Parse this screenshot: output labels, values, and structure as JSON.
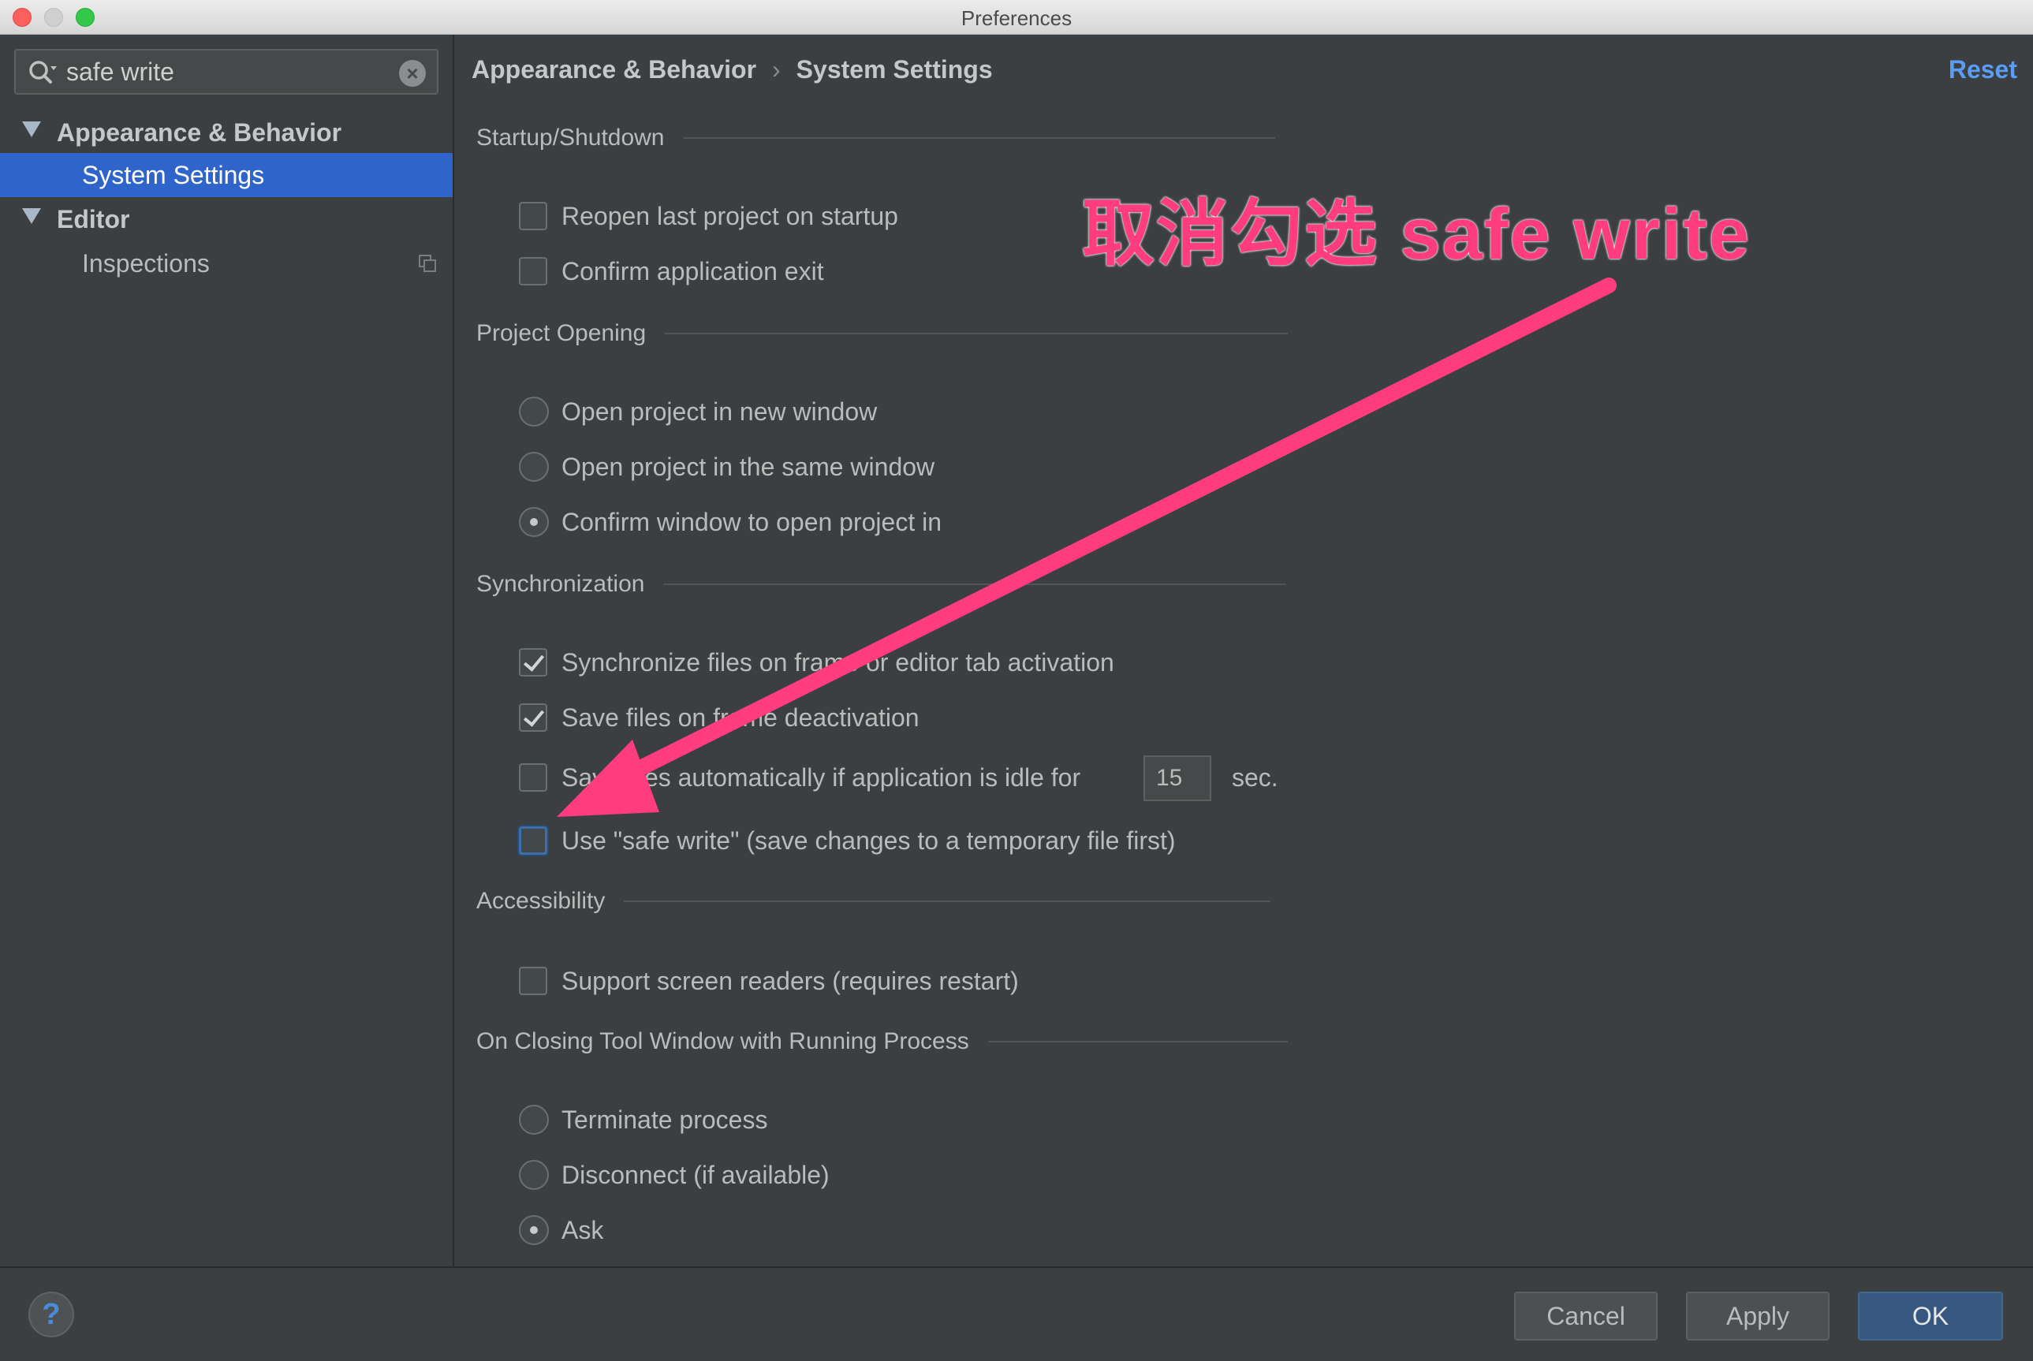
{
  "window": {
    "title": "Preferences"
  },
  "sidebar": {
    "search_value": "safe write",
    "tree": [
      {
        "label": "Appearance & Behavior",
        "level": "group"
      },
      {
        "label": "System Settings",
        "level": "child",
        "selected": true
      },
      {
        "label": "Editor",
        "level": "group"
      },
      {
        "label": "Inspections",
        "level": "child"
      }
    ]
  },
  "header": {
    "breadcrumb": [
      "Appearance & Behavior",
      "System Settings"
    ],
    "breadcrumb_sep": "›",
    "reset_label": "Reset"
  },
  "sections": {
    "startup": {
      "title": "Startup/Shutdown",
      "options": [
        {
          "label": "Reopen last project on startup",
          "checked": false
        },
        {
          "label": "Confirm application exit",
          "checked": false
        }
      ]
    },
    "project_opening": {
      "title": "Project Opening",
      "options": [
        {
          "label": "Open project in new window",
          "checked": false
        },
        {
          "label": "Open project in the same window",
          "checked": false
        },
        {
          "label": "Confirm window to open project in",
          "checked": true
        }
      ]
    },
    "sync": {
      "title": "Synchronization",
      "options": [
        {
          "label": "Synchronize files on frame or editor tab activation",
          "checked": true
        },
        {
          "label": "Save files on frame deactivation",
          "checked": true
        },
        {
          "label": "Save files automatically if application is idle for",
          "checked": false,
          "value": "15",
          "unit": "sec."
        },
        {
          "label": "Use \"safe write\" (save changes to a temporary file first)",
          "checked": false
        }
      ]
    },
    "accessibility": {
      "title": "Accessibility",
      "options": [
        {
          "label": "Support screen readers (requires restart)",
          "checked": false
        }
      ]
    },
    "closing": {
      "title": "On Closing Tool Window with Running Process",
      "options": [
        {
          "label": "Terminate process",
          "checked": false
        },
        {
          "label": "Disconnect (if available)",
          "checked": false
        },
        {
          "label": "Ask",
          "checked": true
        }
      ]
    }
  },
  "annotation": {
    "text": "取消勾选 safe write",
    "color": "#ff3c7e"
  },
  "footer": {
    "help_label": "?",
    "cancel_label": "Cancel",
    "apply_label": "Apply",
    "ok_label": "OK"
  }
}
